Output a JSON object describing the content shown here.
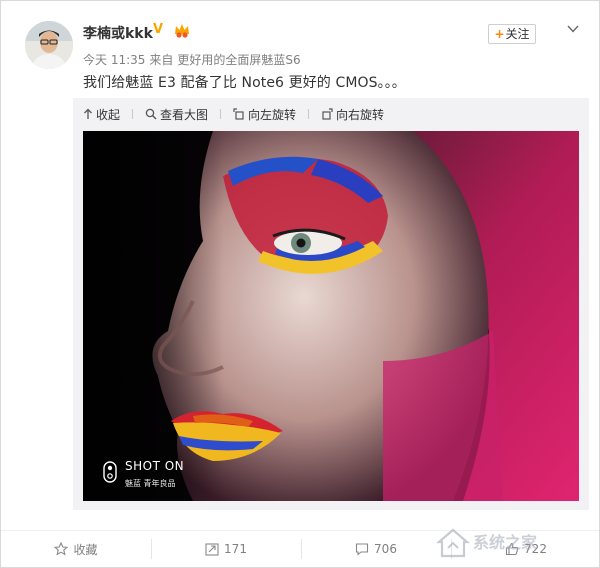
{
  "post": {
    "username": "李楠或kkk",
    "verified_badge": "V",
    "follow_label": "关注",
    "follow_plus": "+",
    "time": "今天 11:35",
    "source_prefix": "来自",
    "source": "更好用的全面屏魅蓝S6",
    "text": "我们给魅蓝 E3 配备了比 Note6 更好的 CMOS。。。"
  },
  "image_toolbar": [
    {
      "icon": "collapse-arrow-icon",
      "label": "收起"
    },
    {
      "icon": "magnifier-icon",
      "label": "查看大图"
    },
    {
      "icon": "rotate-left-icon",
      "label": "向左旋转"
    },
    {
      "icon": "rotate-right-icon",
      "label": "向右旋转"
    }
  ],
  "photo": {
    "watermark_label": "SHOT ON",
    "watermark_sub": "魅蓝 青年良品"
  },
  "actions": {
    "favorite": {
      "icon": "star-icon",
      "label": "收藏"
    },
    "repost": {
      "icon": "repost-icon",
      "count": "171"
    },
    "comment": {
      "icon": "comment-icon",
      "count": "706"
    },
    "like": {
      "icon": "thumbs-up-icon",
      "count": "722"
    }
  },
  "site_watermark": {
    "text": "系统之家"
  },
  "colors": {
    "accent": "#ff8200",
    "badge": "#f7a600",
    "muted": "#808080",
    "panel": "#f2f2f5"
  }
}
